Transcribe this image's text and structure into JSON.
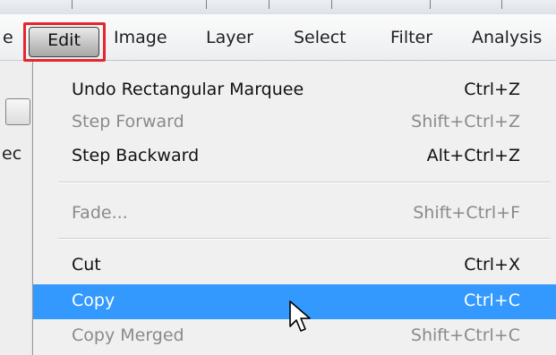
{
  "menubar": {
    "partial_left": "e",
    "items": [
      "Edit",
      "Image",
      "Layer",
      "Select",
      "Filter",
      "Analysis"
    ]
  },
  "left_panel": {
    "partial_text": "ec"
  },
  "edit_menu": {
    "items": [
      {
        "label": "Undo Rectangular Marquee",
        "shortcut": "Ctrl+Z",
        "state": "enabled"
      },
      {
        "label": "Step Forward",
        "shortcut": "Shift+Ctrl+Z",
        "state": "disabled"
      },
      {
        "label": "Step Backward",
        "shortcut": "Alt+Ctrl+Z",
        "state": "enabled"
      },
      {
        "label": "Fade...",
        "shortcut": "Shift+Ctrl+F",
        "state": "disabled"
      },
      {
        "label": "Cut",
        "shortcut": "Ctrl+X",
        "state": "enabled"
      },
      {
        "label": "Copy",
        "shortcut": "Ctrl+C",
        "state": "highlighted"
      },
      {
        "label": "Copy Merged",
        "shortcut": "Shift+Ctrl+C",
        "state": "disabled"
      }
    ]
  },
  "colors": {
    "highlight": "#3399ff",
    "annotation_box": "#e8252c",
    "disabled_text": "#8a8a8a"
  },
  "icons": {
    "cursor": "mouse-pointer-icon"
  }
}
